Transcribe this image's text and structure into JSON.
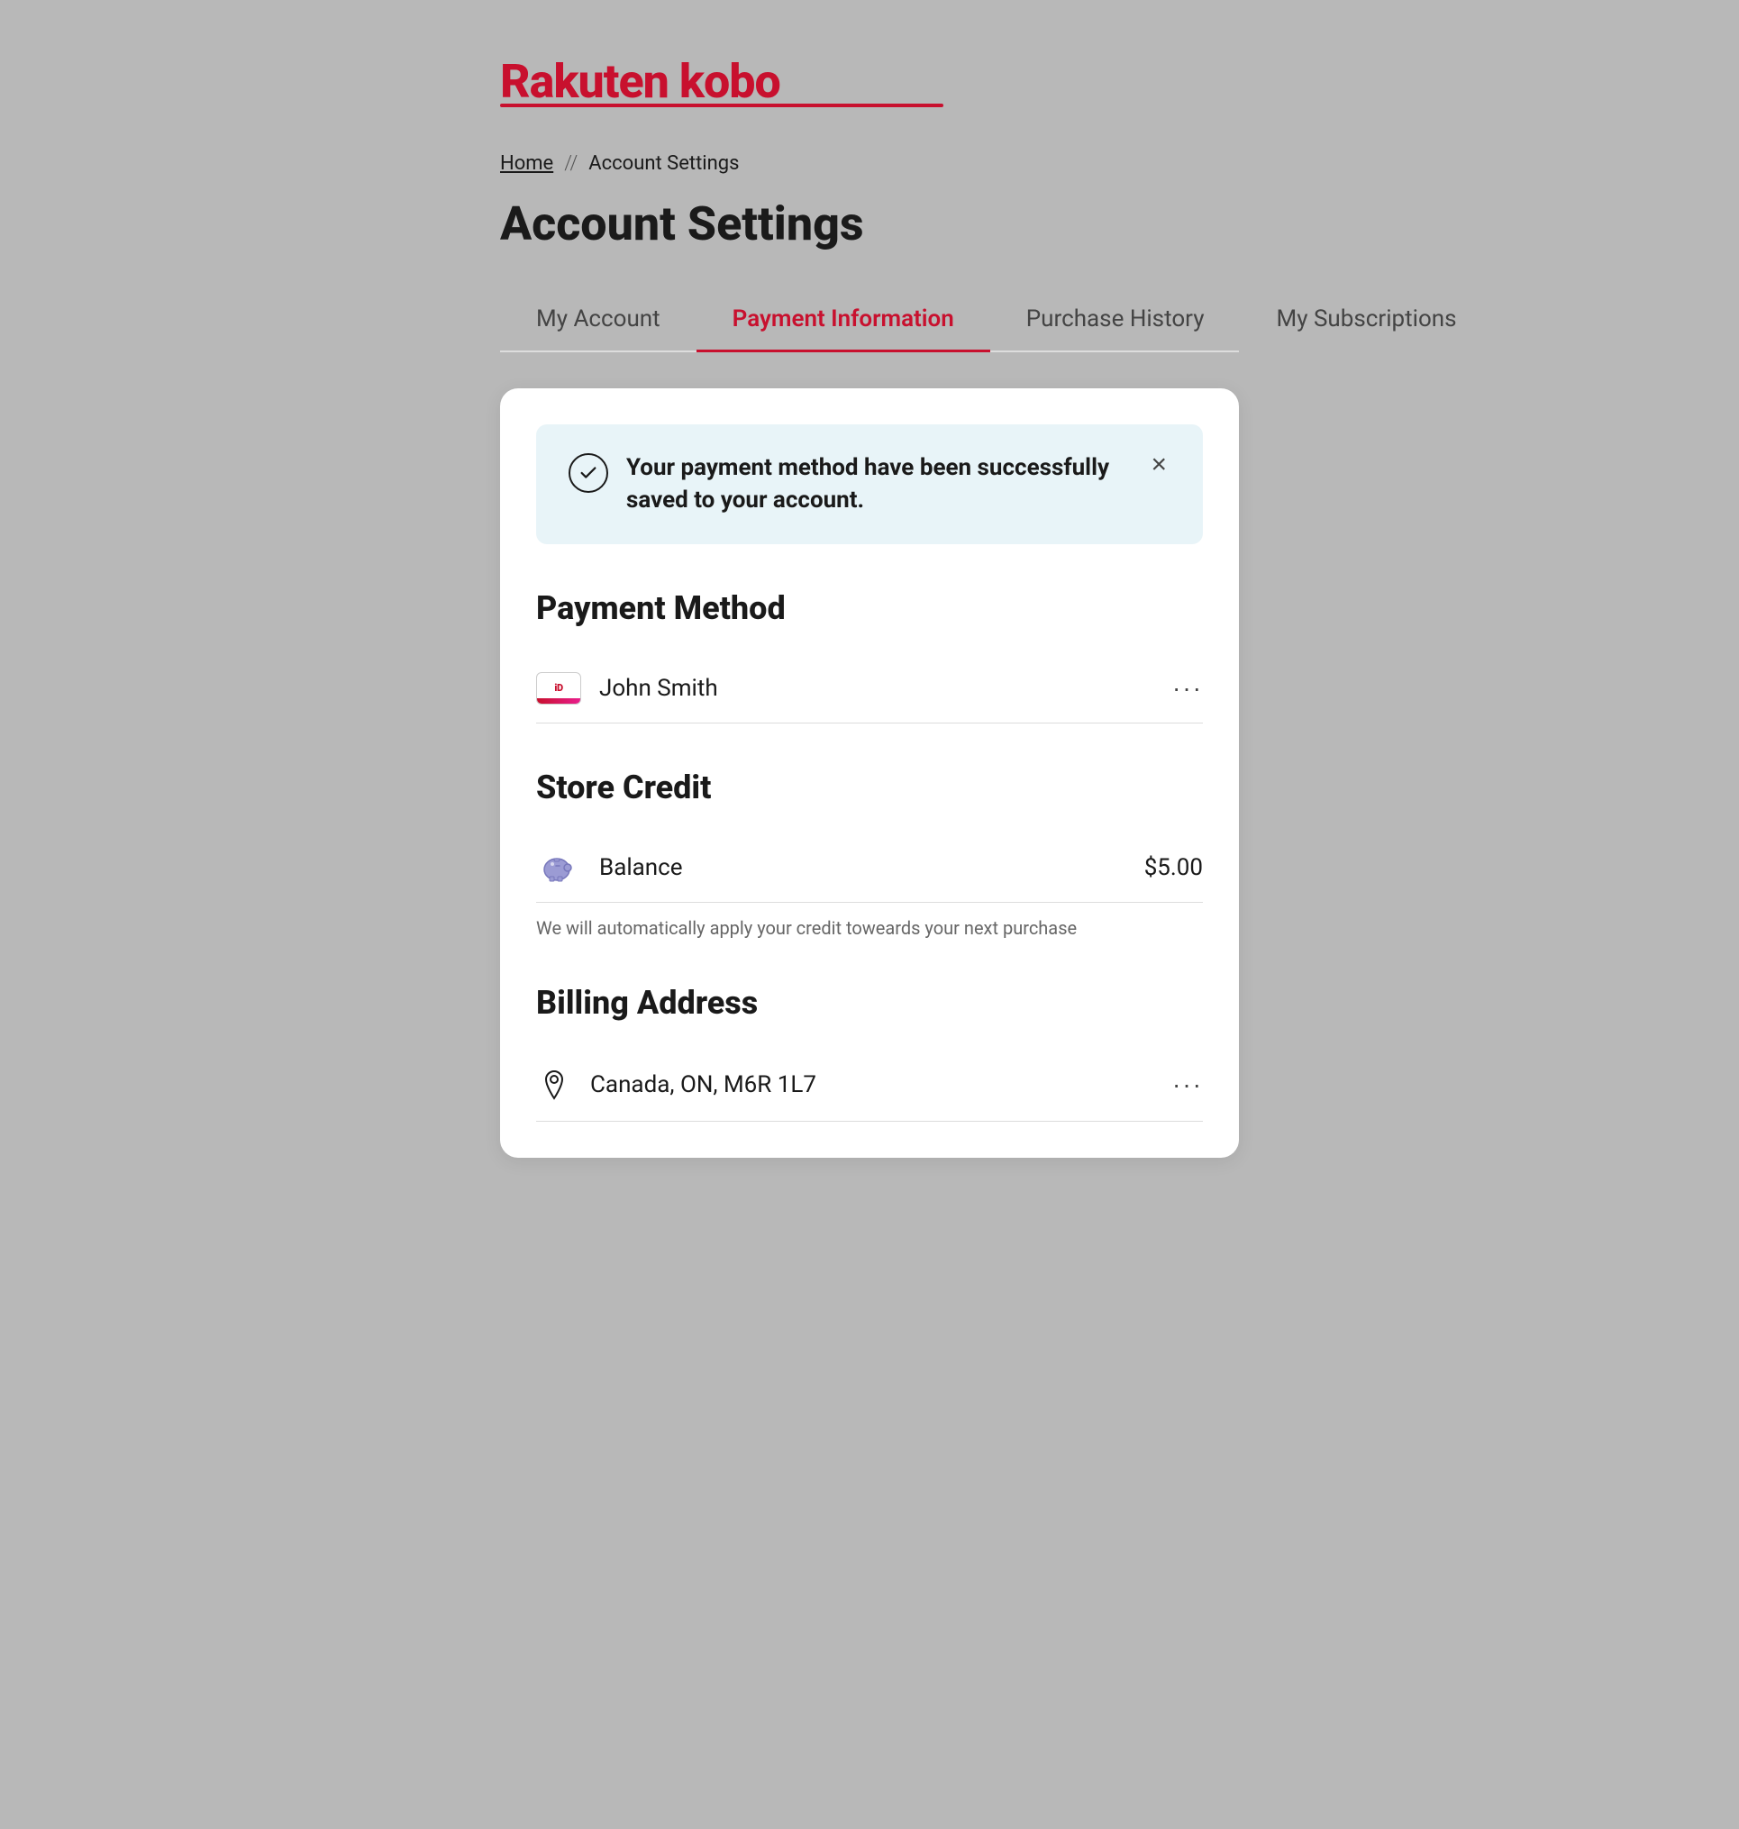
{
  "logo": {
    "text": "Rakuten kobo"
  },
  "breadcrumb": {
    "home": "Home",
    "separator": "//",
    "current": "Account Settings"
  },
  "page": {
    "title": "Account Settings"
  },
  "tabs": [
    {
      "id": "my-account",
      "label": "My Account",
      "active": false
    },
    {
      "id": "payment-information",
      "label": "Payment Information",
      "active": true
    },
    {
      "id": "purchase-history",
      "label": "Purchase History",
      "active": false
    },
    {
      "id": "my-subscriptions",
      "label": "My Subscriptions",
      "active": false
    }
  ],
  "success_banner": {
    "message": "Your payment method have been successfully saved to your account.",
    "close_label": "×"
  },
  "payment_method": {
    "section_title": "Payment Method",
    "item": {
      "name": "John Smith",
      "icon_label": "iDEAL",
      "more_label": "···"
    }
  },
  "store_credit": {
    "section_title": "Store Credit",
    "label": "Balance",
    "amount": "$5.00",
    "note": "We will automatically apply your credit toweards your next purchase",
    "more_label": ""
  },
  "billing_address": {
    "section_title": "Billing Address",
    "address": "Canada, ON, M6R 1L7",
    "more_label": "···"
  }
}
